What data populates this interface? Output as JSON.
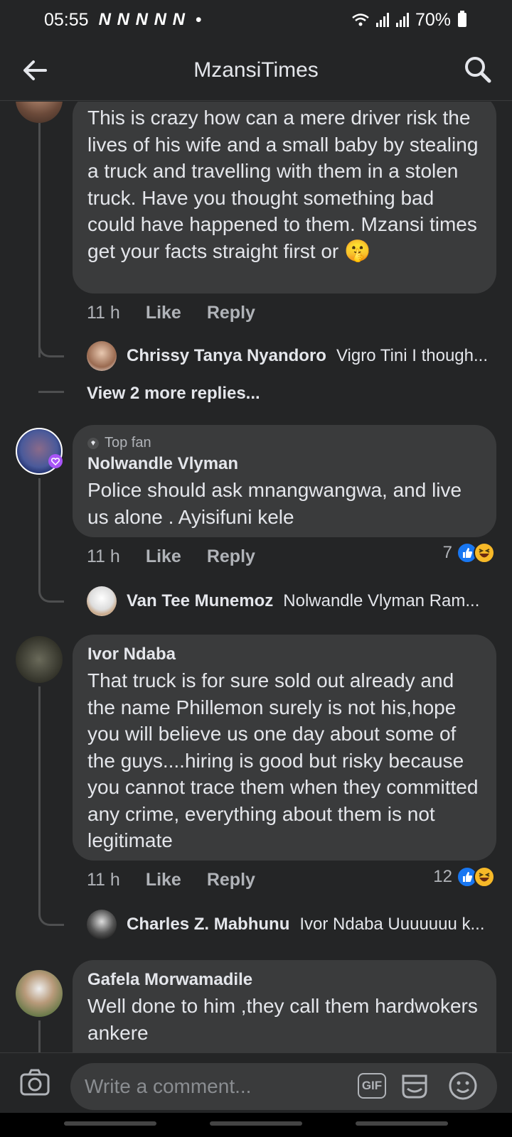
{
  "status_bar": {
    "time": "05:55",
    "notifications": "N N N N N",
    "dot": "•",
    "battery": "70%"
  },
  "header": {
    "title": "MzansiTimes",
    "back_icon": "arrow-left-icon",
    "search_icon": "search-icon"
  },
  "comments": [
    {
      "text_lines": "This is crazy how can a mere driver risk the lives of his wife and a small baby by stealing a truck and travelling with them in a stolen truck. Have you thought something bad could have happened to them. Mzansi times get your facts straight first or",
      "emoji": "🤫",
      "time": "11 h",
      "like": "Like",
      "reply": "Reply",
      "replies": [
        {
          "name": "Chrissy Tanya Nyandoro",
          "snippet": "Vigro Tini I though..."
        }
      ],
      "view_more": "View 2 more replies..."
    },
    {
      "badge": "Top fan",
      "author": "Nolwandle Vlyman",
      "text": "Police should ask mnangwangwa, and live us alone . Ayisifuni kele",
      "time": "11 h",
      "like": "Like",
      "reply": "Reply",
      "reaction_count": "7",
      "replies": [
        {
          "name": "Van Tee Munemoz",
          "snippet": "Nolwandle Vlyman Ram..."
        }
      ]
    },
    {
      "author": "Ivor Ndaba",
      "text": "That truck is for sure sold out already and the name Phillemon surely is not his,hope you will believe us one day about some of the guys....hiring is good but risky because you cannot trace them when they committed any crime, everything about them is not legitimate",
      "time": "11 h",
      "like": "Like",
      "reply": "Reply",
      "reaction_count": "12",
      "replies": [
        {
          "name": "Charles Z. Mabhunu",
          "snippet": "Ivor Ndaba Uuuuuuu k..."
        }
      ]
    },
    {
      "author": "Gafela Morwamadile",
      "text": "Well done to him ,they call them hardwokers ankere"
    }
  ],
  "composer": {
    "placeholder": "Write a comment...",
    "gif_label": "GIF"
  },
  "colors": {
    "background": "#242526",
    "bubble": "#3a3b3c",
    "text": "#e4e6eb",
    "muted": "#b0b3b8",
    "like_blue": "#1877f2",
    "haha_yellow": "#f7b928"
  }
}
